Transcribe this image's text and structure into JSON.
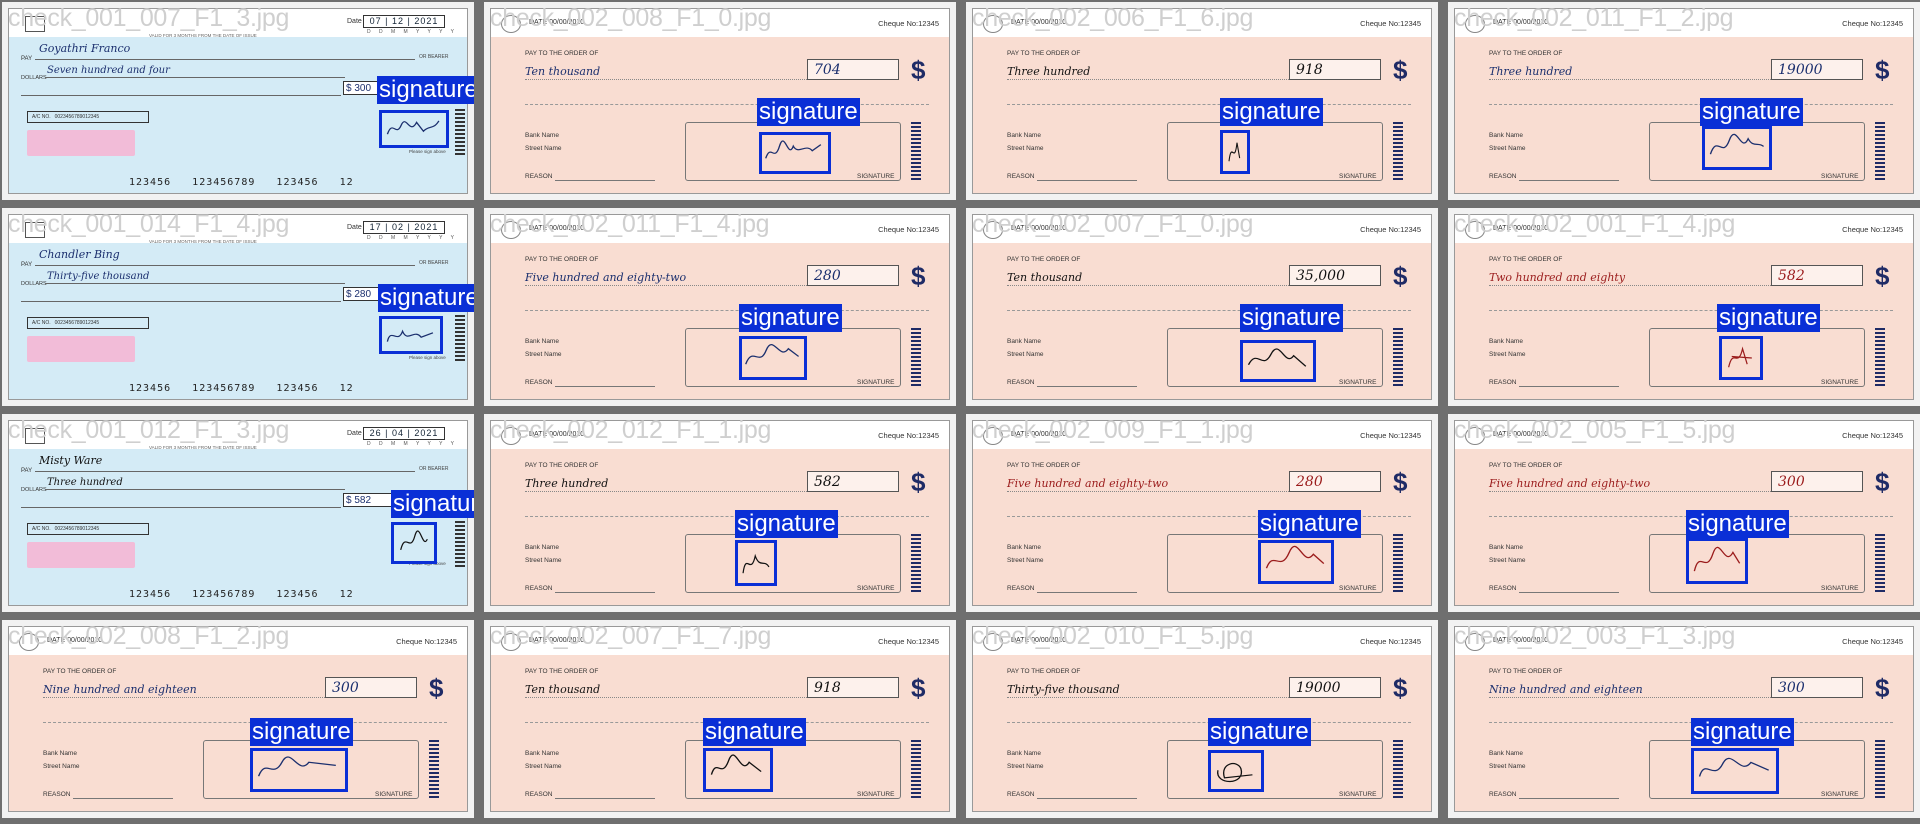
{
  "label_text": "signature",
  "colors": {
    "box": "#0a2fd6",
    "ink_blue": "#1b2f6e",
    "ink_black": "#111111",
    "ink_red": "#9b1c1c"
  },
  "static_text": {
    "date_label": "Date",
    "ddmm": "D D M M Y Y Y Y",
    "pay_label": "PAY",
    "or_bearer": "OR BEARER",
    "dollars_label": "DOLLARS",
    "ac_no": "A/C NO.",
    "account_number": "0023456789012345",
    "micr": "123456   123456789   123456   12",
    "auth_sign": "Please sign above",
    "peach_date": "DATE 00/00/2010",
    "cheque_no": "Cheque No:12345",
    "pay_to": "PAY TO THE ORDER OF",
    "bank_name": "Bank Name",
    "street_name": "Street Name",
    "reason": "REASON",
    "signature_caption": "SIGNATURE",
    "dollar_sign": "$",
    "void_note": "VALID FOR 3 MONTHS FROM THE DATE OF ISSUE"
  },
  "tiles": [
    {
      "filename": "check_001_007_F1_3.jpg",
      "style": "blue",
      "payee": "Goyathri Franco",
      "words": "Seven hundred and four",
      "amount": "$ 300",
      "date": "07 | 12 | 2021",
      "ink": "ink_blue"
    },
    {
      "filename": "check_002_008_F1_0.jpg",
      "style": "peach",
      "words": "Ten thousand",
      "amount": "704",
      "ink": "ink_blue"
    },
    {
      "filename": "check_002_006_F1_6.jpg",
      "style": "peach",
      "words": "Three hundred",
      "amount": "918",
      "ink": "ink_black"
    },
    {
      "filename": "check_002_011_F1_2.jpg",
      "style": "peach",
      "words": "Three hundred",
      "amount": "19000",
      "ink": "ink_blue"
    },
    {
      "filename": "check_001_014_F1_4.jpg",
      "style": "blue",
      "payee": "Chandler Bing",
      "words": "Thirty-five thousand",
      "amount": "$ 280",
      "date": "17 | 02 | 2021",
      "ink": "ink_blue"
    },
    {
      "filename": "check_002_011_F1_4.jpg",
      "style": "peach",
      "words": "Five hundred and eighty-two",
      "amount": "280",
      "ink": "ink_blue"
    },
    {
      "filename": "check_002_007_F1_0.jpg",
      "style": "peach",
      "words": "Ten thousand",
      "amount": "35,000",
      "ink": "ink_black"
    },
    {
      "filename": "check_002_001_F1_4.jpg",
      "style": "peach",
      "words": "Two hundred and eighty",
      "amount": "582",
      "ink": "ink_red"
    },
    {
      "filename": "check_001_012_F1_3.jpg",
      "style": "blue",
      "payee": "Misty Ware",
      "words": "Three hundred",
      "amount": "$ 582",
      "date": "26 | 04 | 2021",
      "ink": "ink_black"
    },
    {
      "filename": "check_002_012_F1_1.jpg",
      "style": "peach",
      "words": "Three hundred",
      "amount": "582",
      "ink": "ink_black"
    },
    {
      "filename": "check_002_009_F1_1.jpg",
      "style": "peach",
      "words": "Five hundred and eighty-two",
      "amount": "280",
      "ink": "ink_red"
    },
    {
      "filename": "check_002_005_F1_5.jpg",
      "style": "peach",
      "words": "Five hundred and eighty-two",
      "amount": "300",
      "ink": "ink_red"
    },
    {
      "filename": "check_002_008_F1_2.jpg",
      "style": "peach",
      "words": "Nine hundred and eighteen",
      "amount": "300",
      "ink": "ink_blue"
    },
    {
      "filename": "check_002_007_F1_7.jpg",
      "style": "peach",
      "words": "Ten thousand",
      "amount": "918",
      "ink": "ink_black"
    },
    {
      "filename": "check_002_010_F1_5.jpg",
      "style": "peach",
      "words": "Thirty-five thousand",
      "amount": "19000",
      "ink": "ink_black"
    },
    {
      "filename": "check_002_003_F1_3.jpg",
      "style": "peach",
      "words": "Nine hundred and eighteen",
      "amount": "300",
      "ink": "ink_blue"
    }
  ]
}
